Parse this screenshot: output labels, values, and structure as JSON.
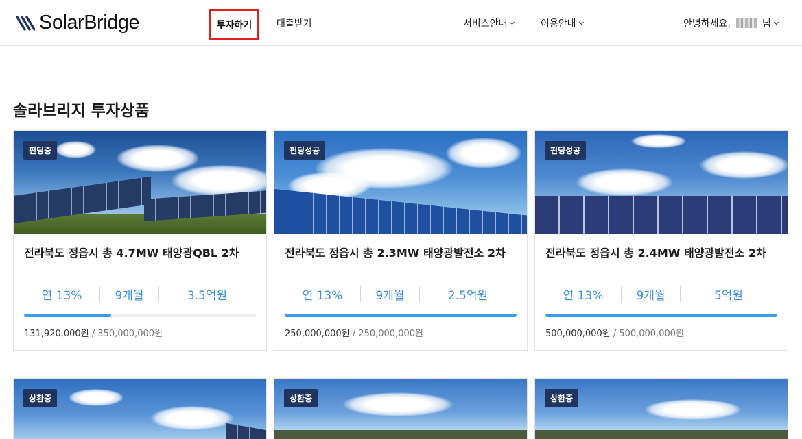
{
  "header": {
    "logo_text": "SolarBridge",
    "nav": {
      "invest": "투자하기",
      "loan": "대출받기",
      "service_info": "서비스안내",
      "usage_info": "이용안내"
    },
    "user": {
      "greeting": "안녕하세요,",
      "suffix": "님"
    }
  },
  "main": {
    "section_title": "솔라브리지 투자상품",
    "products": [
      {
        "badge": "펀딩중",
        "title": "전라북도 정읍시 총 4.7MW 태양광QBL 2차",
        "rate": "연 13%",
        "period": "9개월",
        "amount": "3.5억원",
        "progress_percent": 37.7,
        "raised": "131,920,000원",
        "goal": "/ 350,000,000원"
      },
      {
        "badge": "펀딩성공",
        "title": "전라북도 정읍시 총 2.3MW 태양광발전소 2차",
        "rate": "연 13%",
        "period": "9개월",
        "amount": "2.5억원",
        "progress_percent": 100,
        "raised": "250,000,000원",
        "goal": "/ 250,000,000원"
      },
      {
        "badge": "펀딩성공",
        "title": "전라북도 정읍시 총 2.4MW 태양광발전소 2차",
        "rate": "연 13%",
        "period": "9개월",
        "amount": "5억원",
        "progress_percent": 100,
        "raised": "500,000,000원",
        "goal": "/ 500,000,000원"
      },
      {
        "badge": "상환중"
      },
      {
        "badge": "상환중"
      },
      {
        "badge": "상환중"
      }
    ]
  },
  "colors": {
    "accent_blue": "#3b8fe4",
    "badge_navy": "#1f3560",
    "highlight_red": "#e0201b"
  }
}
